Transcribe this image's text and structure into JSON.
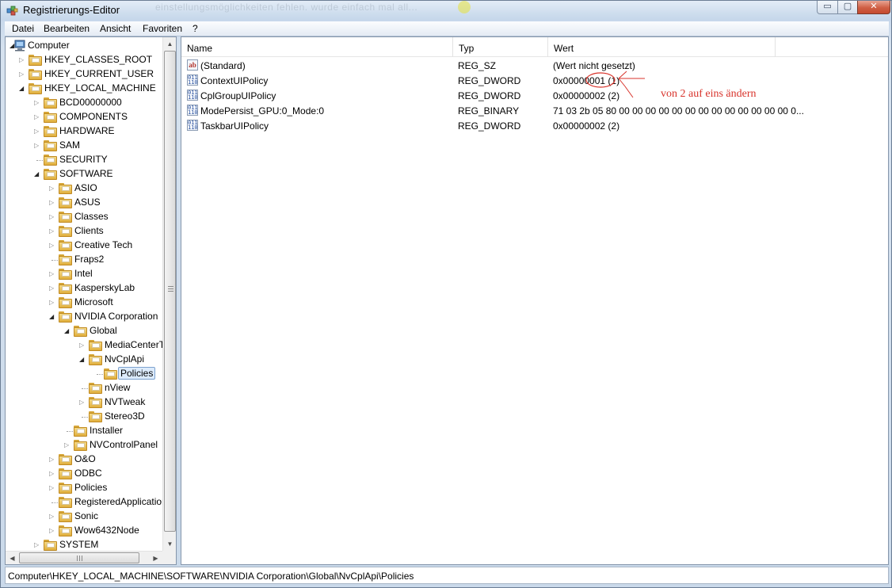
{
  "window": {
    "title": "Registrierungs-Editor",
    "background_text": "einstellungsmöglichkeiten fehlen. wurde einfach mal all...",
    "minimize": "▭",
    "maximize": "▢",
    "close": "✕"
  },
  "menu": [
    "Datei",
    "Bearbeiten",
    "Ansicht",
    "Favoriten",
    "?"
  ],
  "tree": {
    "root": "Computer",
    "nodes": [
      {
        "label": "HKEY_CLASSES_ROOT",
        "level": 1,
        "expander": "closed"
      },
      {
        "label": "HKEY_CURRENT_USER",
        "level": 1,
        "expander": "closed"
      },
      {
        "label": "HKEY_LOCAL_MACHINE",
        "level": 1,
        "expander": "open"
      },
      {
        "label": "BCD00000000",
        "level": 2,
        "expander": "closed"
      },
      {
        "label": "COMPONENTS",
        "level": 2,
        "expander": "closed"
      },
      {
        "label": "HARDWARE",
        "level": 2,
        "expander": "closed"
      },
      {
        "label": "SAM",
        "level": 2,
        "expander": "closed"
      },
      {
        "label": "SECURITY",
        "level": 2,
        "expander": "none"
      },
      {
        "label": "SOFTWARE",
        "level": 2,
        "expander": "open"
      },
      {
        "label": "ASIO",
        "level": 3,
        "expander": "closed"
      },
      {
        "label": "ASUS",
        "level": 3,
        "expander": "closed"
      },
      {
        "label": "Classes",
        "level": 3,
        "expander": "closed"
      },
      {
        "label": "Clients",
        "level": 3,
        "expander": "closed"
      },
      {
        "label": "Creative Tech",
        "level": 3,
        "expander": "closed"
      },
      {
        "label": "Fraps2",
        "level": 3,
        "expander": "none"
      },
      {
        "label": "Intel",
        "level": 3,
        "expander": "closed"
      },
      {
        "label": "KasperskyLab",
        "level": 3,
        "expander": "closed"
      },
      {
        "label": "Microsoft",
        "level": 3,
        "expander": "closed"
      },
      {
        "label": "NVIDIA Corporation",
        "level": 3,
        "expander": "open"
      },
      {
        "label": "Global",
        "level": 4,
        "expander": "open"
      },
      {
        "label": "MediaCenterT",
        "level": 5,
        "expander": "closed"
      },
      {
        "label": "NvCplApi",
        "level": 5,
        "expander": "open"
      },
      {
        "label": "Policies",
        "level": 6,
        "expander": "none",
        "selected": true
      },
      {
        "label": "nView",
        "level": 5,
        "expander": "none"
      },
      {
        "label": "NVTweak",
        "level": 5,
        "expander": "closed"
      },
      {
        "label": "Stereo3D",
        "level": 5,
        "expander": "none"
      },
      {
        "label": "Installer",
        "level": 4,
        "expander": "none"
      },
      {
        "label": "NVControlPanel",
        "level": 4,
        "expander": "closed"
      },
      {
        "label": "O&O",
        "level": 3,
        "expander": "closed"
      },
      {
        "label": "ODBC",
        "level": 3,
        "expander": "closed"
      },
      {
        "label": "Policies",
        "level": 3,
        "expander": "closed"
      },
      {
        "label": "RegisteredApplicatior",
        "level": 3,
        "expander": "none"
      },
      {
        "label": "Sonic",
        "level": 3,
        "expander": "closed"
      },
      {
        "label": "Wow6432Node",
        "level": 3,
        "expander": "closed"
      },
      {
        "label": "SYSTEM",
        "level": 2,
        "expander": "closed"
      }
    ]
  },
  "list": {
    "columns": [
      "Name",
      "Typ",
      "Wert"
    ],
    "rows": [
      {
        "icon": "string-value-icon",
        "icon_text": "ab",
        "name": "(Standard)",
        "type": "REG_SZ",
        "value": "(Wert nicht gesetzt)"
      },
      {
        "icon": "binary-value-icon",
        "icon_text": "011 110",
        "name": "ContextUIPolicy",
        "type": "REG_DWORD",
        "value": "0x00000001 (1)"
      },
      {
        "icon": "binary-value-icon",
        "icon_text": "011 110",
        "name": "CplGroupUIPolicy",
        "type": "REG_DWORD",
        "value": "0x00000002 (2)"
      },
      {
        "icon": "binary-value-icon",
        "icon_text": "011 110",
        "name": "ModePersist_GPU:0_Mode:0",
        "type": "REG_BINARY",
        "value": "71 03 2b 05 80 00 00 00 00 00 00 00 00 00 00 00 00 00 0..."
      },
      {
        "icon": "binary-value-icon",
        "icon_text": "011 110",
        "name": "TaskbarUIPolicy",
        "type": "REG_DWORD",
        "value": "0x00000002 (2)"
      }
    ]
  },
  "annotation": "von 2 auf eins ändern",
  "status": "Computer\\HKEY_LOCAL_MACHINE\\SOFTWARE\\NVIDIA Corporation\\Global\\NvCplApi\\Policies",
  "colors": {
    "annotation": "#d8332b",
    "selection": "#dcebfc",
    "folder": "#e8bd55"
  }
}
